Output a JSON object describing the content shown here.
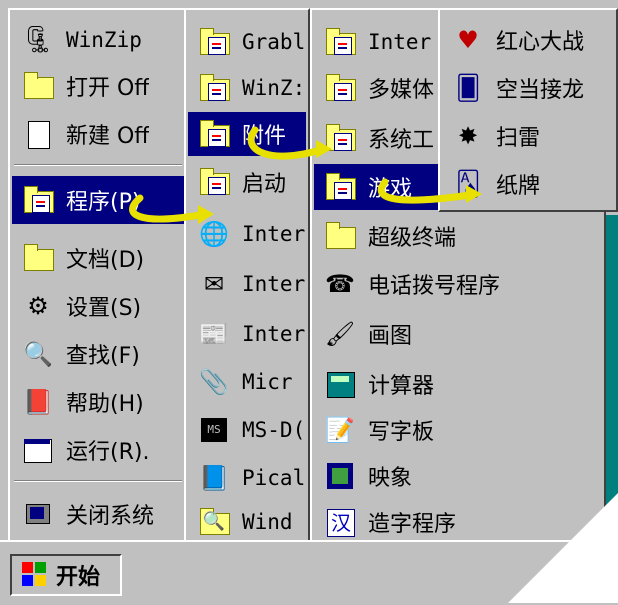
{
  "main_menu": {
    "items": [
      {
        "label": "WinZip",
        "icon": "winzip-icon"
      },
      {
        "label": "打开 Off",
        "icon": "open-office-icon"
      },
      {
        "label": "新建 Off",
        "icon": "new-office-icon"
      },
      {
        "label": "程序(P)",
        "icon": "programs-icon"
      },
      {
        "label": "文档(D)",
        "icon": "documents-icon"
      },
      {
        "label": "设置(S)",
        "icon": "settings-icon"
      },
      {
        "label": "查找(F)",
        "icon": "find-icon"
      },
      {
        "label": "帮助(H)",
        "icon": "help-icon"
      },
      {
        "label": "运行(R).",
        "icon": "run-icon"
      },
      {
        "label": "关闭系统",
        "icon": "shutdown-icon"
      }
    ]
  },
  "programs_menu": {
    "items": [
      {
        "label": "Grabl",
        "icon": "folder-icon"
      },
      {
        "label": "WinZ:",
        "icon": "folder-icon"
      },
      {
        "label": "附件",
        "icon": "folder-icon"
      },
      {
        "label": "启动",
        "icon": "folder-icon"
      },
      {
        "label": "Inter",
        "icon": "internet-explorer-icon"
      },
      {
        "label": "Inter",
        "icon": "internet-mail-icon"
      },
      {
        "label": "Inter",
        "icon": "internet-news-icon"
      },
      {
        "label": "Micr",
        "icon": "exchange-icon"
      },
      {
        "label": "MS-D(",
        "icon": "ms-dos-icon"
      },
      {
        "label": "Pical",
        "icon": "picasa-icon"
      },
      {
        "label": "Wind",
        "icon": "windows-explorer-icon"
      }
    ]
  },
  "accessories_menu": {
    "items": [
      {
        "label": "Inter",
        "icon": "folder-icon"
      },
      {
        "label": "多媒体",
        "icon": "folder-icon"
      },
      {
        "label": "系统工",
        "icon": "folder-icon"
      },
      {
        "label": "游戏",
        "icon": "folder-icon"
      },
      {
        "label": "超级终端",
        "icon": "folder-plain-icon"
      },
      {
        "label": "电话拨号程序",
        "icon": "phone-dialer-icon"
      },
      {
        "label": "画图",
        "icon": "paint-icon"
      },
      {
        "label": "计算器",
        "icon": "calculator-icon"
      },
      {
        "label": "写字板",
        "icon": "wordpad-icon"
      },
      {
        "label": "映象",
        "icon": "imaging-icon"
      },
      {
        "label": "造字程序",
        "icon": "char-editor-icon"
      }
    ]
  },
  "games_menu": {
    "items": [
      {
        "label": "红心大战",
        "icon": "hearts-icon"
      },
      {
        "label": "空当接龙",
        "icon": "freecell-icon"
      },
      {
        "label": "扫雷",
        "icon": "minesweeper-icon"
      },
      {
        "label": "纸牌",
        "icon": "solitaire-icon"
      }
    ]
  },
  "taskbar": {
    "start_label": "开始",
    "start_icon": "windows-logo-icon"
  }
}
